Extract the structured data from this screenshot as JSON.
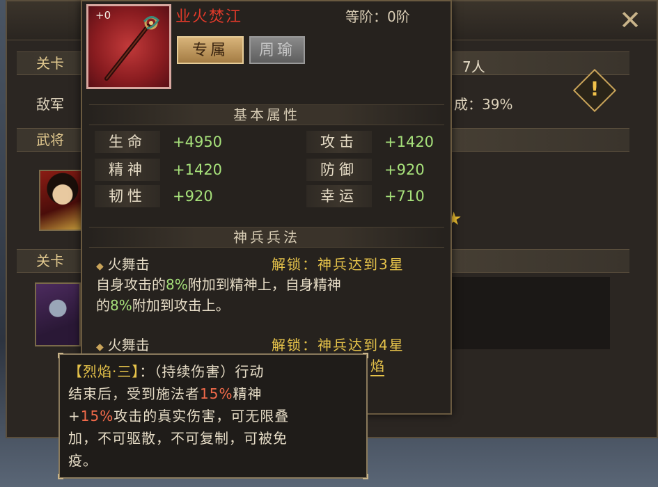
{
  "background": {
    "close_icon": "close-x-icon",
    "band1_label": "关卡",
    "band1_right": "7人",
    "row_enemy_label": "敌军",
    "row_enemy_right": "成：39%",
    "band2_label": "武将",
    "band3_label": "关卡",
    "warning_icon": "exclamation-diamond-icon",
    "warning_mark": "!",
    "star_icon": "★"
  },
  "item": {
    "plus_level": "+0",
    "name": "业火焚江",
    "grade": "等阶：0阶",
    "tag_exclusive": "专属",
    "tag_hero": "周瑜",
    "icon": "red-staff-icon"
  },
  "basic_section_title": "基本属性",
  "attributes": [
    {
      "label": "生命",
      "value": "+4950"
    },
    {
      "label": "攻击",
      "value": "+1420"
    },
    {
      "label": "精神",
      "value": "+1420"
    },
    {
      "label": "防御",
      "value": "+920"
    },
    {
      "label": "韧性",
      "value": "+920"
    },
    {
      "label": "幸运",
      "value": "+710"
    }
  ],
  "skill_section_title": "神兵兵法",
  "skills": [
    {
      "name": "火舞击",
      "unlock": "解锁：神兵达到3星",
      "desc_p1": "自身攻击的",
      "desc_pct1": "8%",
      "desc_p2": "附加到精神上，自身精神",
      "desc_p3": "的",
      "desc_pct2": "8%",
      "desc_p4": "附加到攻击上。"
    },
    {
      "name": "火舞击",
      "unlock": "解锁：神兵达到4星",
      "peek": "焰"
    }
  ],
  "tooltip": {
    "keyword": "【烈焰·三】",
    "line1_rest": "：（持续伤害）行动",
    "line2_p1": "结束后，受到施法者",
    "line2_pct": "15%",
    "line2_p2": "精神",
    "line3_p1": "+",
    "line3_pct": "15%",
    "line3_p2": "攻击的真实伤害，可无限叠",
    "line4": "加，不可驱散，不可复制，可被免",
    "line5": "疫。"
  }
}
